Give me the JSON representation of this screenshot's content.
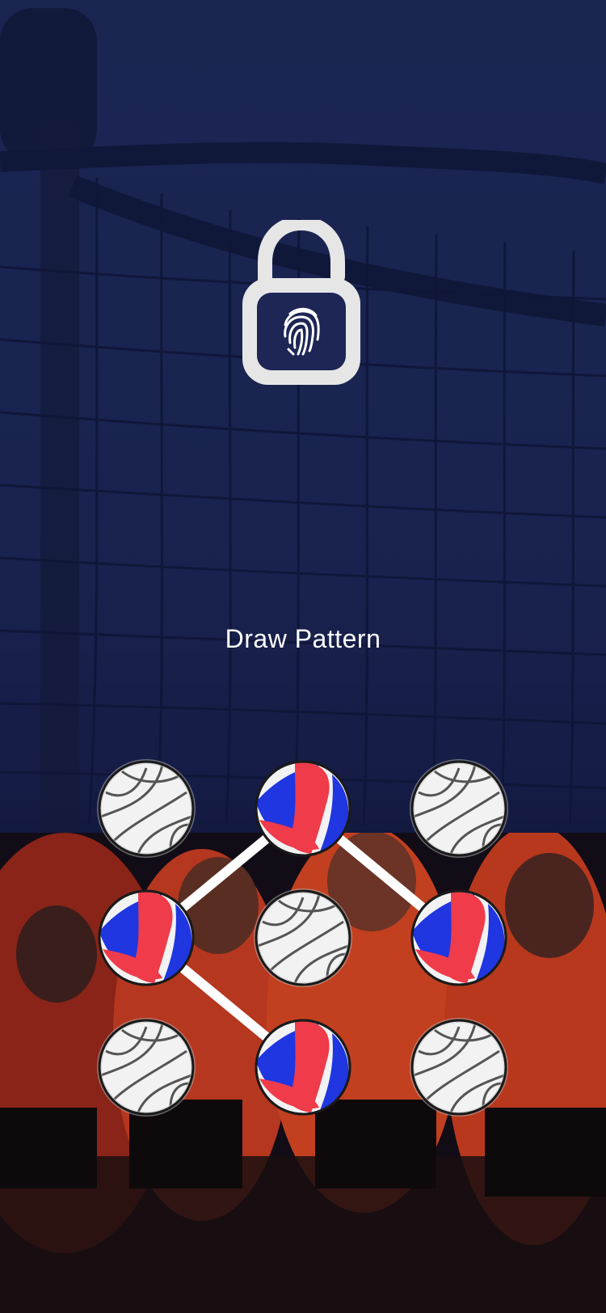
{
  "screen": {
    "title": "Draw Pattern"
  },
  "lock": {
    "icon": "padlock-fingerprint-icon",
    "state": "unlocked"
  },
  "pattern": {
    "grid_size": 3,
    "nodes": [
      {
        "id": 1,
        "selected": false
      },
      {
        "id": 2,
        "selected": true
      },
      {
        "id": 3,
        "selected": false
      },
      {
        "id": 4,
        "selected": true
      },
      {
        "id": 5,
        "selected": false
      },
      {
        "id": 6,
        "selected": true
      },
      {
        "id": 7,
        "selected": false
      },
      {
        "id": 8,
        "selected": true
      },
      {
        "id": 9,
        "selected": false
      }
    ],
    "connected_sequence": [
      6,
      2,
      4,
      8
    ]
  },
  "colors": {
    "background_top": "#1b2552",
    "background_bottom": "#0b0f26",
    "ball_red": "#ef3b4a",
    "ball_blue": "#1f36e0",
    "ball_white": "#f2f2f2",
    "pattern_line": "#ffffff",
    "text": "#ffffff"
  }
}
